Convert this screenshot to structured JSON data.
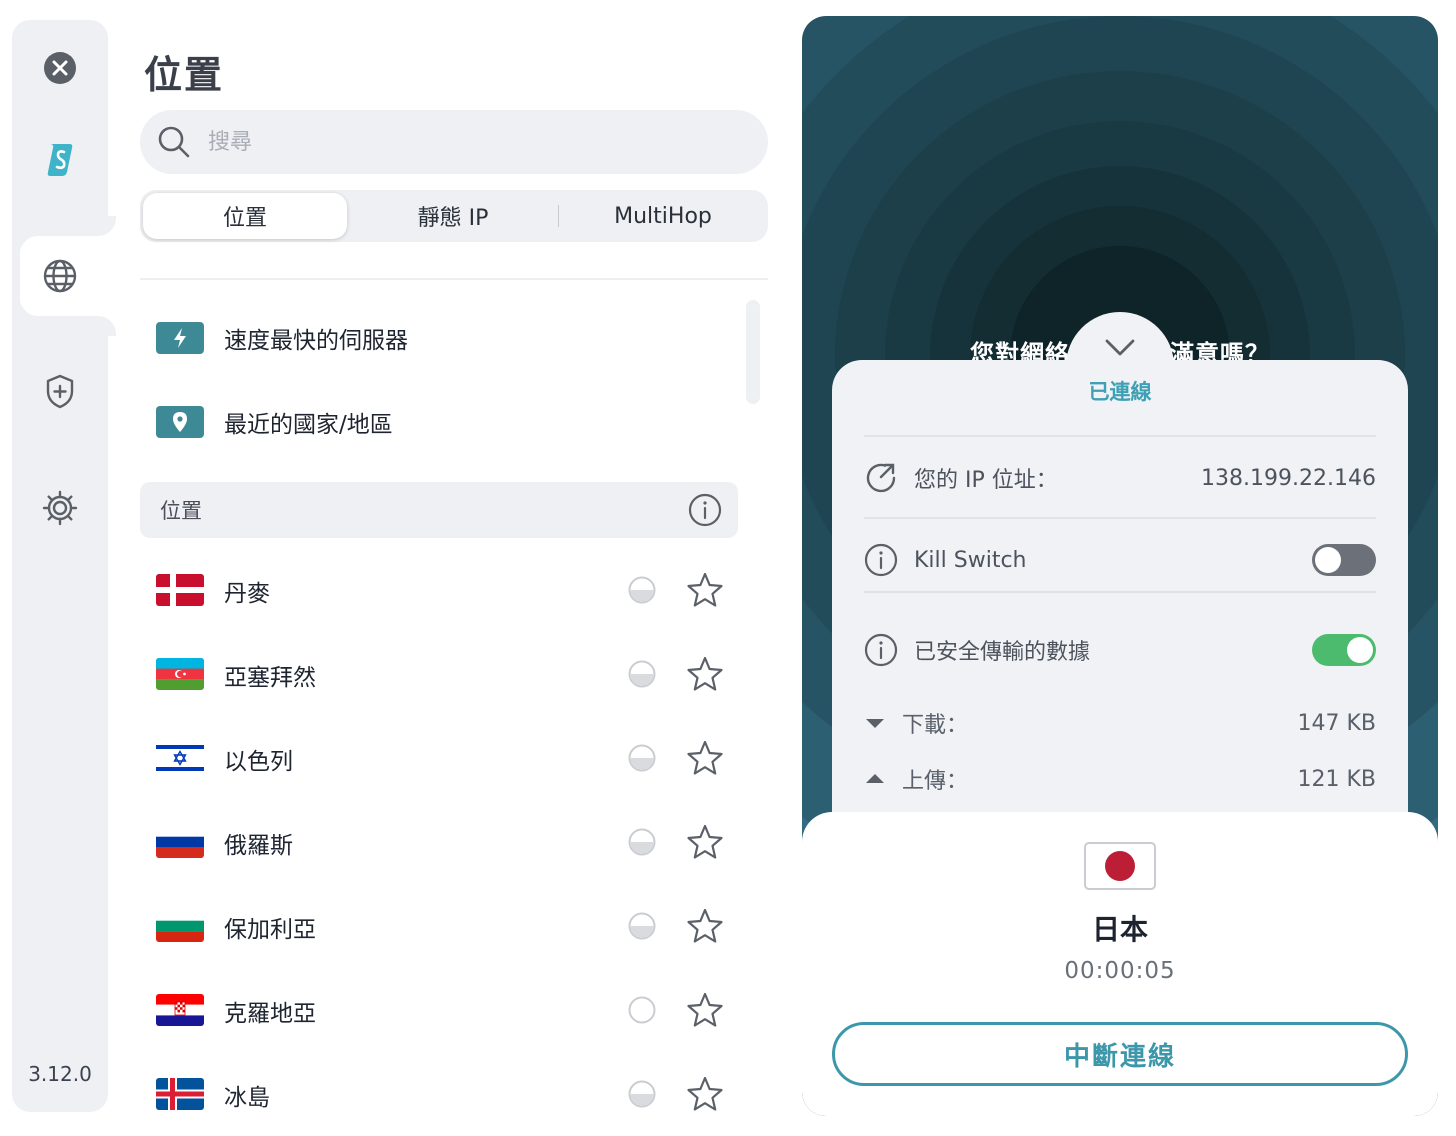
{
  "sidebar": {
    "version": "3.12.0",
    "icons": [
      "close-icon",
      "surfshark-logo-icon",
      "globe-icon",
      "shield-plus-icon",
      "gear-icon"
    ]
  },
  "locations_panel": {
    "title": "位置",
    "search": {
      "placeholder": "搜尋",
      "value": ""
    },
    "tabs": [
      {
        "label": "位置",
        "active": true
      },
      {
        "label": "靜態 IP",
        "active": false
      },
      {
        "label": "MultiHop",
        "active": false
      }
    ],
    "quick_items": [
      {
        "label": "速度最快的伺服器",
        "icon": "lightning-icon"
      },
      {
        "label": "最近的國家/地區",
        "icon": "location-pin-icon"
      }
    ],
    "section_header": "位置",
    "countries": [
      {
        "name": "丹麥",
        "flag": "denmark-flag"
      },
      {
        "name": "亞塞拜然",
        "flag": "azerbaijan-flag"
      },
      {
        "name": "以色列",
        "flag": "israel-flag"
      },
      {
        "name": "俄羅斯",
        "flag": "russia-flag"
      },
      {
        "name": "保加利亞",
        "flag": "bulgaria-flag"
      },
      {
        "name": "克羅地亞",
        "flag": "croatia-flag"
      },
      {
        "name": "冰島",
        "flag": "iceland-flag"
      }
    ]
  },
  "connection_panel": {
    "banner_left": "您對網絡",
    "banner_right": "滿意嗎？",
    "status": "已連線",
    "ip_label": "您的 IP 位址：",
    "ip_value": "138.199.22.146",
    "kill_switch_label": "Kill Switch",
    "kill_switch_on": false,
    "secure_data_label": "已安全傳輸的數據",
    "secure_data_on": true,
    "download_label": "下載：",
    "download_value": "147 KB",
    "upload_label": "上傳：",
    "upload_value": "121 KB",
    "location": "日本",
    "timer": "00:00:05",
    "disconnect_label": "中斷連線",
    "colors": {
      "accent": "#3d97ab",
      "toggle_on": "#4cbb6e",
      "toggle_off": "#6b7079"
    }
  }
}
